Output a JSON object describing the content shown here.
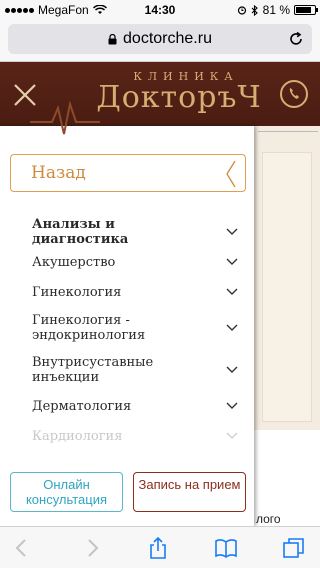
{
  "status_bar": {
    "carrier": "MegaFon",
    "time": "14:30",
    "battery_percent_text": "81 %",
    "battery_level": 0.81
  },
  "browser": {
    "url": "doctorche.ru"
  },
  "site": {
    "logo_top": "КЛИНИКА",
    "logo_main": "ДокторъЧ",
    "background_text": "лого"
  },
  "menu": {
    "back_label": "Назад",
    "items": [
      {
        "label": "Анализы и диагностика"
      },
      {
        "label": "Акушерство"
      },
      {
        "label": "Гинекология"
      },
      {
        "label": "Гинекология - эндокринология"
      },
      {
        "label": "Внутрисуставные инъекции"
      },
      {
        "label": "Дерматология"
      },
      {
        "label": "Кардиология"
      }
    ],
    "online_button": "Онлайн консультация",
    "book_button": "Запись на прием"
  },
  "colors": {
    "header_brown": "#4a1c12",
    "logo_gold": "#d6ad72",
    "accent_orange": "#e0a052",
    "online_blue": "#2ea5c0",
    "book_red": "#8c2f1f"
  }
}
